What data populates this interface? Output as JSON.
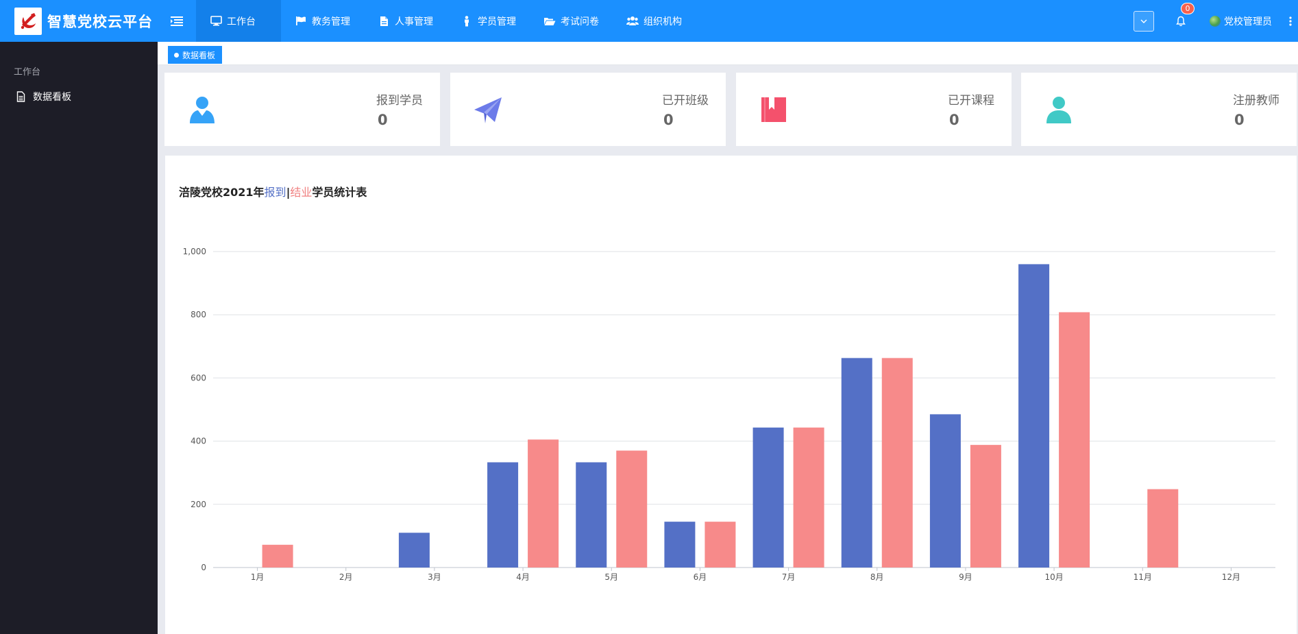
{
  "app": {
    "title": "智慧党校云平台"
  },
  "nav": {
    "items": [
      {
        "label": "工作台",
        "icon": "monitor-icon"
      },
      {
        "label": "教务管理",
        "icon": "flag-icon"
      },
      {
        "label": "人事管理",
        "icon": "document-icon"
      },
      {
        "label": "学员管理",
        "icon": "person-icon"
      },
      {
        "label": "考试问卷",
        "icon": "folder-open-icon"
      },
      {
        "label": "组织机构",
        "icon": "users-icon"
      }
    ]
  },
  "header": {
    "notification_count": "0",
    "user_name": "党校管理员"
  },
  "sidebar": {
    "group_label": "工作台",
    "items": [
      {
        "label": "数据看板",
        "icon": "file-icon"
      }
    ]
  },
  "tabs": [
    {
      "label": "数据看板"
    }
  ],
  "stats": [
    {
      "label": "报到学员",
      "value": "0",
      "icon": "user-icon",
      "color": "#36a3f7"
    },
    {
      "label": "已开班级",
      "value": "0",
      "icon": "paper-plane-icon",
      "color": "#6c7be9"
    },
    {
      "label": "已开课程",
      "value": "0",
      "icon": "book-icon",
      "color": "#f4516c"
    },
    {
      "label": "注册教师",
      "value": "0",
      "icon": "teacher-icon",
      "color": "#40c9c6"
    }
  ],
  "colors": {
    "primary": "#1b90ff",
    "sidebar_bg": "#1d1d27",
    "series_registered": "#5470c6",
    "series_graduated": "#f78a8a"
  },
  "chart_data": {
    "type": "bar",
    "title_parts": {
      "prefix": "涪陵党校2021年",
      "series1": "报到",
      "separator": "|",
      "series2": "结业",
      "suffix": "学员统计表"
    },
    "categories": [
      "1月",
      "2月",
      "3月",
      "4月",
      "5月",
      "6月",
      "7月",
      "8月",
      "9月",
      "10月",
      "11月",
      "12月"
    ],
    "series": [
      {
        "key": "registered",
        "values": [
          0,
          0,
          110,
          333,
          333,
          145,
          443,
          663,
          485,
          960,
          0,
          0
        ]
      },
      {
        "key": "graduated",
        "values": [
          72,
          0,
          0,
          405,
          370,
          145,
          443,
          663,
          388,
          808,
          248,
          0
        ]
      }
    ],
    "ylim": [
      0,
      1000
    ],
    "yticks": [
      0,
      200,
      400,
      600,
      800,
      1000
    ],
    "ytick_labels": [
      "0",
      "200",
      "400",
      "600",
      "800",
      "1,000"
    ],
    "grid": true,
    "legend": "none"
  }
}
